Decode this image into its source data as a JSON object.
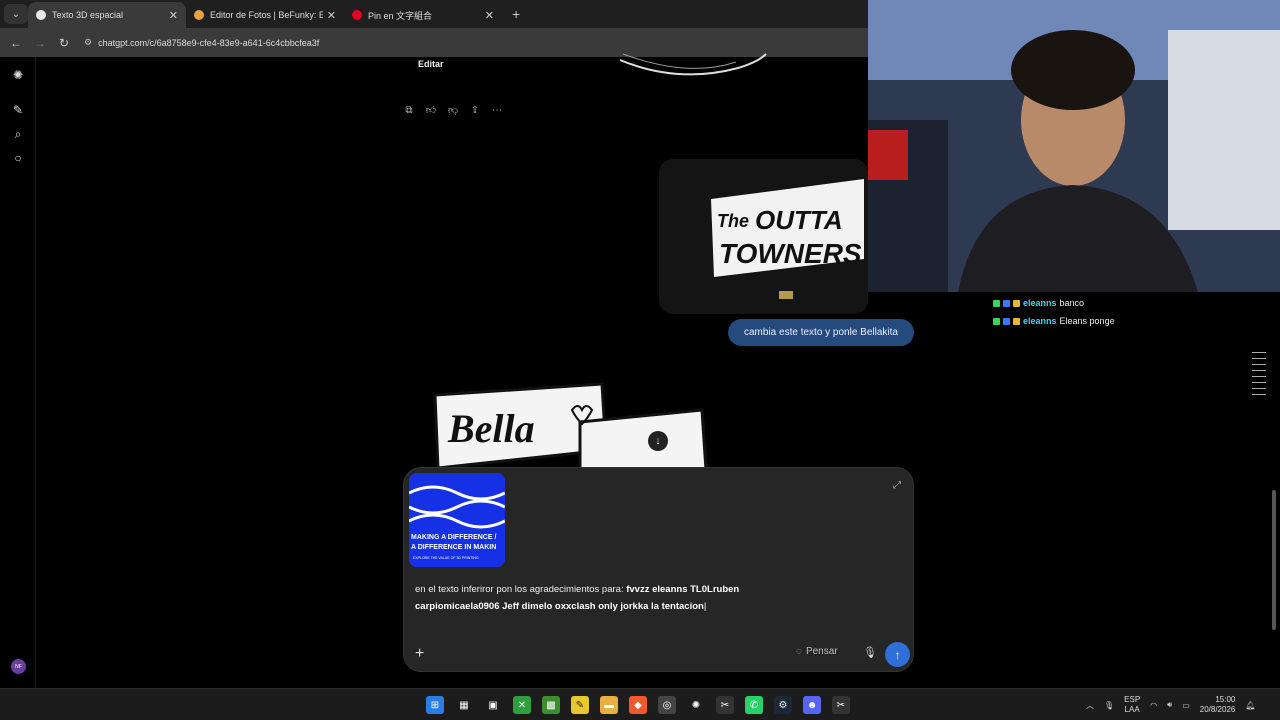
{
  "browser": {
    "tabs": [
      {
        "label": "Texto 3D espacial",
        "active": true,
        "color": "#e8e8e8"
      },
      {
        "label": "Editor de Fotos | BeFunky: Edita",
        "active": false,
        "color": "#e8a33c"
      },
      {
        "label": "Pin en 文字組合",
        "active": false,
        "color": "#e60023"
      }
    ],
    "url": "chatgpt.com/c/6a8758e9-cfe4-83e9-a641-6c4cbbcfea3f"
  },
  "chat": {
    "edit_label": "Editar",
    "user_message": "cambia este texto y ponle Bellakita",
    "composer": {
      "prompt_prefix": "en el texto inferiror pon los agradecimientos para: ",
      "prompt_bold": "fvvzz eleanns TL0Lruben carpiomicaela0906 Jeff dimelo oxxclash only jorkka la tentacion",
      "think_label": "Pensar",
      "attachment_lines": [
        "MAKING A DIFFERENCE /",
        "A DIFFERENCE IN MAKIN",
        "EXPLORE THE VALUE OF 3D PRINTING"
      ]
    },
    "user_image_text": [
      "The",
      "OUTTA",
      "TOWNERS"
    ],
    "bella_text": "Bella"
  },
  "stream_chat": [
    {
      "user": "eleanns",
      "message": "banco"
    },
    {
      "user": "eleanns",
      "message": "Eleans ponge"
    }
  ],
  "taskbar": {
    "lang_top": "ESP",
    "lang_bottom": "LAA",
    "time": "15:00",
    "date": "20/8/2026"
  },
  "sidebar": {
    "avatar_initials": "NF"
  }
}
